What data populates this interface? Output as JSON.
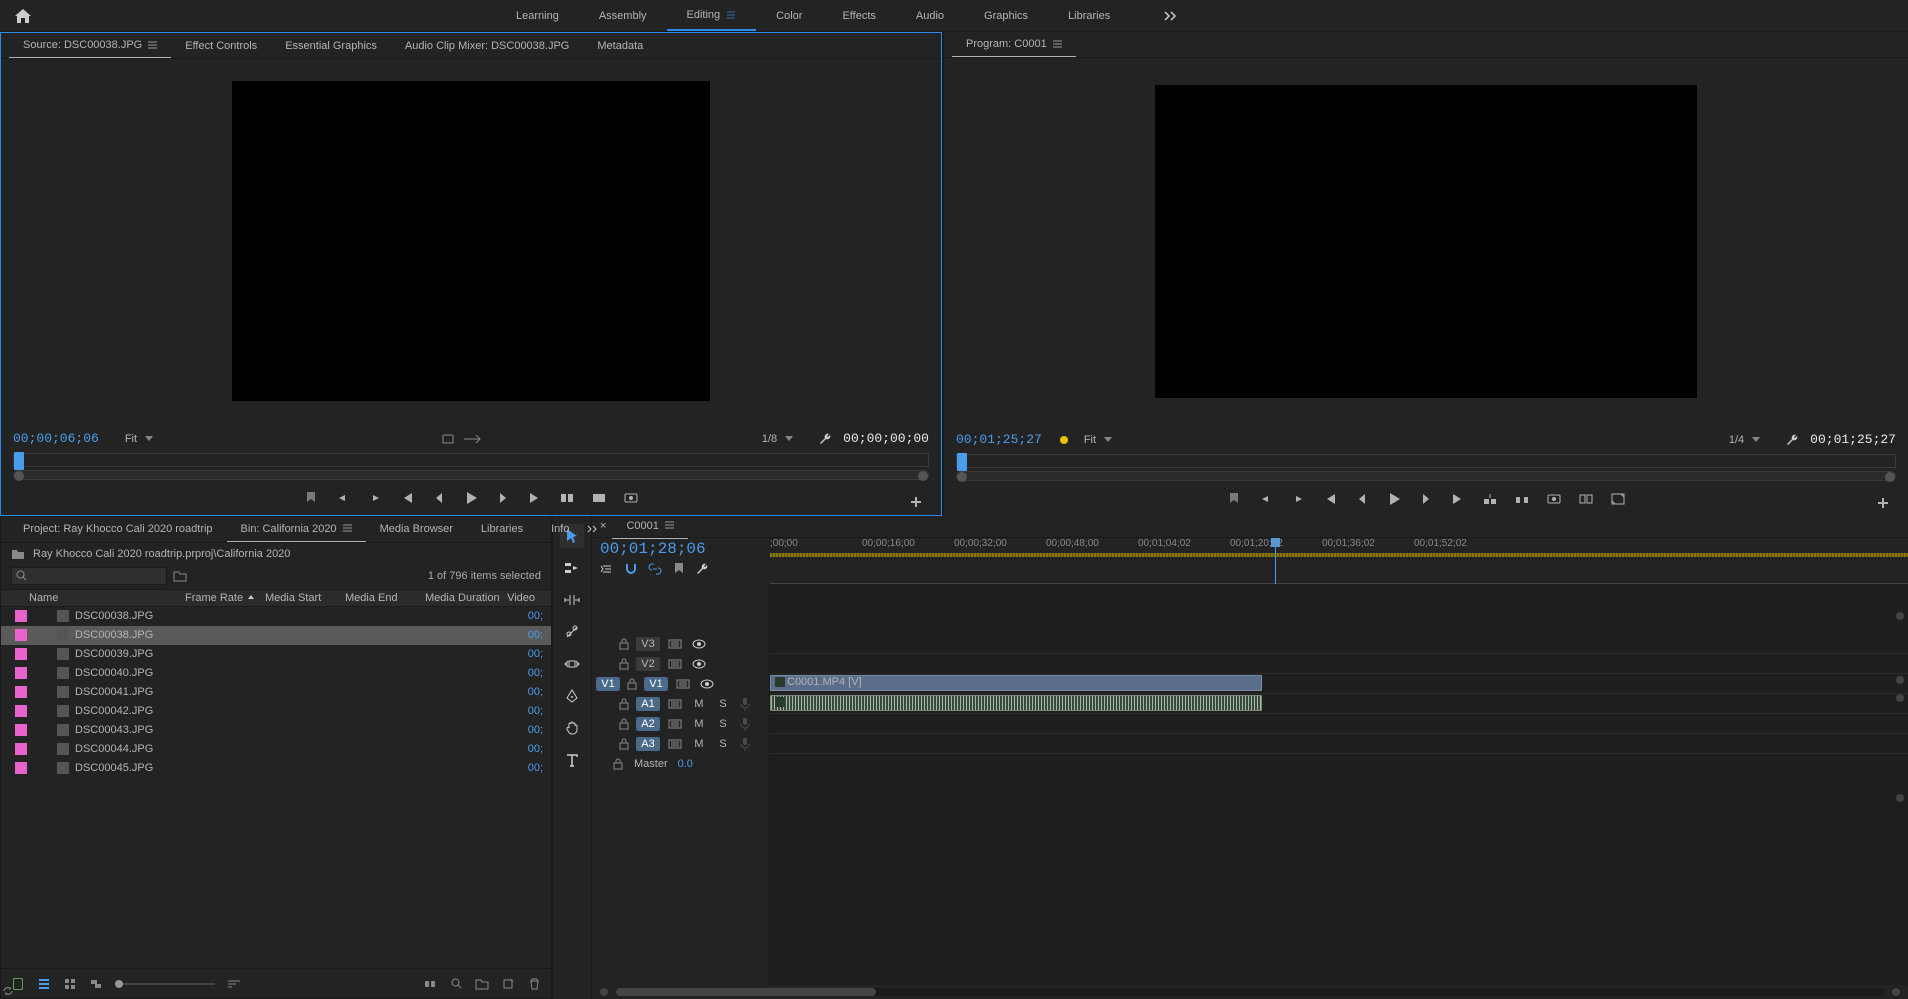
{
  "topbar": {
    "workspaces": [
      "Learning",
      "Assembly",
      "Editing",
      "Color",
      "Effects",
      "Audio",
      "Graphics",
      "Libraries"
    ],
    "active": "Editing"
  },
  "source": {
    "tabs": [
      "Source: DSC00038.JPG",
      "Effect Controls",
      "Essential Graphics",
      "Audio Clip Mixer: DSC00038.JPG",
      "Metadata"
    ],
    "active": 0,
    "playhead": "00;00;06;06",
    "zoom": "Fit",
    "res": "1/8",
    "out": "00;00;00;00"
  },
  "program": {
    "tab": "Program: C0001",
    "playhead": "00;01;25;27",
    "zoom": "Fit",
    "res": "1/4",
    "out": "00;01;25;27"
  },
  "project": {
    "tabs": [
      "Project: Ray Khocco Cali 2020 roadtrip",
      "Bin: California 2020",
      "Media Browser",
      "Libraries",
      "Info"
    ],
    "active": 1,
    "path": "Ray Khocco Cali 2020 roadtrip.prproj\\California 2020",
    "selCount": "1 of 796 items selected",
    "headers": {
      "name": "Name",
      "fr": "Frame Rate",
      "ms": "Media Start",
      "me": "Media End",
      "md": "Media Duration",
      "vi": "Video"
    },
    "items": [
      {
        "name": "DSC00038.JPG",
        "dur": "00;"
      },
      {
        "name": "DSC00038.JPG",
        "dur": "00;",
        "sel": true
      },
      {
        "name": "DSC00039.JPG",
        "dur": "00;"
      },
      {
        "name": "DSC00040.JPG",
        "dur": "00;"
      },
      {
        "name": "DSC00041.JPG",
        "dur": "00;"
      },
      {
        "name": "DSC00042.JPG",
        "dur": "00;"
      },
      {
        "name": "DSC00043.JPG",
        "dur": "00;"
      },
      {
        "name": "DSC00044.JPG",
        "dur": "00;"
      },
      {
        "name": "DSC00045.JPG",
        "dur": "00;"
      }
    ]
  },
  "timeline": {
    "seq": "C0001",
    "tc": "00;01;28;06",
    "ticks": [
      ";00;00",
      "00;00;16;00",
      "00;00;32;00",
      "00;00;48;00",
      "00;01;04;02",
      "00;01;20;02",
      "00;01;36;02",
      "00;01;52;02"
    ],
    "tracks": {
      "v": [
        "V3",
        "V2",
        "V1"
      ],
      "a": [
        "A1",
        "A2",
        "A3"
      ]
    },
    "master": {
      "label": "Master",
      "db": "0.0"
    },
    "clip": "C0001.MP4 [V]"
  }
}
